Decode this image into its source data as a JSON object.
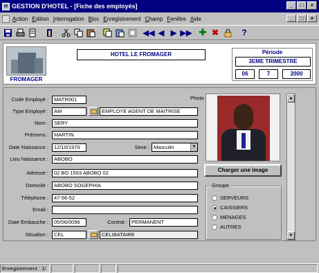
{
  "window": {
    "title": "GESTION D'HOTEL - [Fiche des employés]",
    "controls": [
      "_",
      "□",
      "×"
    ]
  },
  "menu": [
    "Action",
    "Edition",
    "Interrogation",
    "Bloc",
    "Enregistrement",
    "Champ",
    "Fenêtre",
    "Aide"
  ],
  "toolbar": {
    "icons": [
      "save-icon",
      "print-icon",
      "preview-icon",
      "exit-icon",
      "cut-icon",
      "copy-icon",
      "paste-icon",
      "copy-record-icon",
      "paste-record-icon",
      "duplicate-icon",
      "first-record-icon",
      "previous-record-icon",
      "next-record-icon",
      "last-record-icon",
      "insert-record-icon",
      "delete-record-icon",
      "lock-icon",
      "help-icon"
    ],
    "help_label": "?"
  },
  "header": {
    "logo_caption": "FROMAGER",
    "hotel_name": "HOTEL LE FROMAGER",
    "period_title": "Période",
    "period_trimester": "3EME TRIMESTRE",
    "period_day": "06",
    "period_month": "7",
    "period_year": "2000"
  },
  "form": {
    "code_label": "Code Employé :",
    "code_value": "MATR001",
    "type_label": "Type Employé :",
    "type_code": "AM",
    "type_desc": "EMPLOYE AGENT DE MAITRISE",
    "nom_label": "Nom :",
    "nom_value": "SERY",
    "prenoms_label": "Prénoms :",
    "prenoms_value": "MARTIN",
    "naissance_label": "Date Naissance :",
    "naissance_value": "12/10/1970",
    "sexe_label": "Sexe :",
    "sexe_value": "Masculin",
    "lieu_label": "Lieu Naissance :",
    "lieu_value": "ABOBO",
    "adresse_label": "Adresse :",
    "adresse_value": "02 BO 1563 ABOBO 02",
    "domicile_label": "Domicile :",
    "domicile_value": "ABOBO SOGEPHIA",
    "telephone_label": "Téléphone :",
    "telephone_value": "47-56-52",
    "email_label": "Email :",
    "email_value": "",
    "embauche_label": "Date Embauche :",
    "embauche_value": "05/06/0096",
    "contrat_label": "Contrat :",
    "contrat_value": "PERMANENT",
    "situation_label": "Situation :",
    "situation_code": "CEL",
    "situation_desc": "CELIBATAIRE"
  },
  "photo": {
    "label": "Photo",
    "load_button": "Charger une image"
  },
  "groupe": {
    "title": "Groupe",
    "options": [
      "SERVEURS",
      "CAISSIERS",
      "MENAGES",
      "AUTRES"
    ],
    "selected": "CAISSIERS"
  },
  "status": {
    "record": "Enregistrement : 1/"
  }
}
